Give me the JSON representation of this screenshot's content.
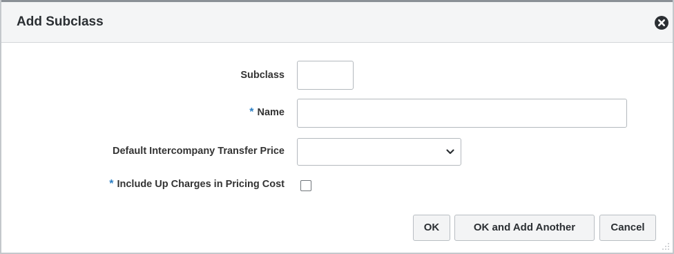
{
  "dialog": {
    "title": "Add Subclass",
    "close_icon": "close-circle-icon"
  },
  "form": {
    "subclass": {
      "label": "Subclass",
      "value": ""
    },
    "name": {
      "label": "Name",
      "required": true,
      "value": ""
    },
    "transfer_price": {
      "label": "Default Intercompany Transfer Price",
      "selected": "",
      "icon": "chevron-down-icon"
    },
    "up_charges": {
      "label": "Include Up Charges in Pricing Cost",
      "required": true,
      "checked": false
    },
    "required_marker": "*"
  },
  "buttons": {
    "ok": "OK",
    "ok_add_another": "OK and Add Another",
    "cancel": "Cancel"
  },
  "colors": {
    "required_marker": "#2c7fc4",
    "title_bar": "#f4f5f6",
    "button_bg": "#f3f4f5"
  }
}
